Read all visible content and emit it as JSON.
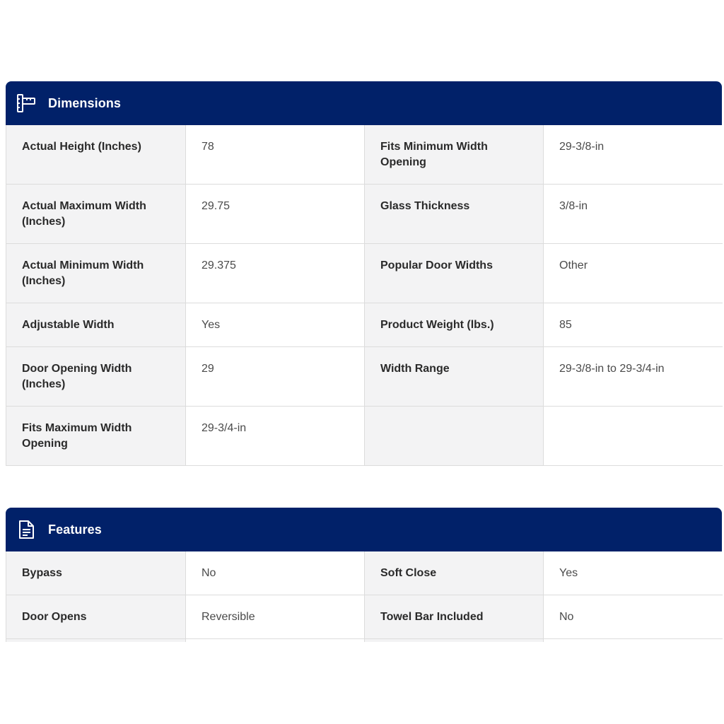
{
  "dimensions": {
    "title": "Dimensions",
    "icon": "ruler-icon",
    "rows": [
      {
        "k1": "Actual Height (Inches)",
        "v1": "78",
        "k2": "Fits Minimum Width Opening",
        "v2": "29-3/8-in"
      },
      {
        "k1": "Actual Maximum Width (Inches)",
        "v1": "29.75",
        "k2": "Glass Thickness",
        "v2": "3/8-in"
      },
      {
        "k1": "Actual Minimum Width (Inches)",
        "v1": "29.375",
        "k2": "Popular Door Widths",
        "v2": "Other"
      },
      {
        "k1": "Adjustable Width",
        "v1": "Yes",
        "k2": "Product Weight (lbs.)",
        "v2": "85"
      },
      {
        "k1": "Door Opening Width (Inches)",
        "v1": "29",
        "k2": "Width Range",
        "v2": "29-3/8-in to 29-3/4-in"
      },
      {
        "k1": "Fits Maximum Width Opening",
        "v1": "29-3/4-in",
        "k2": "",
        "v2": ""
      }
    ]
  },
  "features": {
    "title": "Features",
    "icon": "document-icon",
    "rows": [
      {
        "k1": "Bypass",
        "v1": "No",
        "k2": "Soft Close",
        "v2": "Yes"
      },
      {
        "k1": "Door Opens",
        "v1": "Reversible",
        "k2": "Towel Bar Included",
        "v2": "No"
      }
    ]
  },
  "colors": {
    "header_bg": "#012169",
    "key_bg": "#f3f3f4"
  }
}
